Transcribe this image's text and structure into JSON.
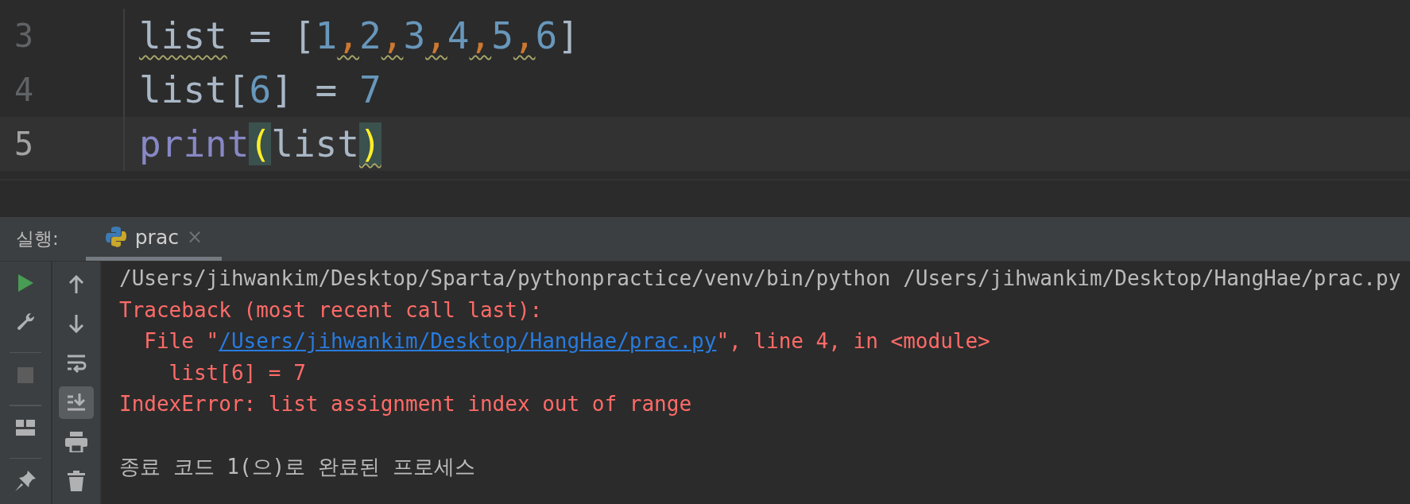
{
  "editor": {
    "lines": [
      {
        "number": "3",
        "current": false,
        "tokens": [
          {
            "text": "list",
            "kind": "identifier",
            "warning": true
          },
          {
            "text": " = [",
            "kind": "operator",
            "warning": false
          },
          {
            "text": "1",
            "kind": "number",
            "warning": false
          },
          {
            "text": ",",
            "kind": "comma",
            "warning": true
          },
          {
            "text": "2",
            "kind": "number",
            "warning": false
          },
          {
            "text": ",",
            "kind": "comma",
            "warning": true
          },
          {
            "text": "3",
            "kind": "number",
            "warning": false
          },
          {
            "text": ",",
            "kind": "comma",
            "warning": true
          },
          {
            "text": "4",
            "kind": "number",
            "warning": false
          },
          {
            "text": ",",
            "kind": "comma",
            "warning": true
          },
          {
            "text": "5",
            "kind": "number",
            "warning": false
          },
          {
            "text": ",",
            "kind": "comma",
            "warning": true
          },
          {
            "text": "6",
            "kind": "number",
            "warning": false
          },
          {
            "text": "]",
            "kind": "operator",
            "warning": false
          }
        ]
      },
      {
        "number": "4",
        "current": false,
        "tokens": [
          {
            "text": "list[",
            "kind": "identifier",
            "warning": false
          },
          {
            "text": "6",
            "kind": "number",
            "warning": false
          },
          {
            "text": "] = ",
            "kind": "operator",
            "warning": false
          },
          {
            "text": "7",
            "kind": "number",
            "warning": false
          }
        ]
      },
      {
        "number": "5",
        "current": true,
        "tokens": [
          {
            "text": "print",
            "kind": "builtin",
            "warning": false
          },
          {
            "text": "(",
            "kind": "paren-match",
            "warning": false
          },
          {
            "text": "list",
            "kind": "identifier",
            "warning": false
          },
          {
            "text": ")",
            "kind": "paren-match",
            "warning": true
          }
        ]
      }
    ]
  },
  "run_panel": {
    "label": "실행:",
    "tabs": [
      {
        "label": "prac",
        "close": "×",
        "selected": true
      }
    ],
    "left_toolbar": [
      {
        "kind": "run",
        "disabled": false
      },
      {
        "kind": "wrench",
        "disabled": false
      },
      {
        "kind": "stop",
        "disabled": true
      },
      {
        "kind": "layout",
        "disabled": false
      },
      {
        "kind": "pin",
        "disabled": false
      }
    ],
    "right_toolbar": [
      {
        "kind": "up",
        "on": false
      },
      {
        "kind": "down",
        "on": false
      },
      {
        "kind": "wrap",
        "on": false
      },
      {
        "kind": "scroll-end",
        "on": true
      },
      {
        "kind": "print",
        "on": false
      },
      {
        "kind": "trash",
        "on": false
      }
    ],
    "console": [
      {
        "segments": [
          {
            "text": "/Users/jihwankim/Desktop/Sparta/pythonpractice/venv/bin/python /Users/jihwankim/Desktop/HangHae/prac.py",
            "kind": "plain"
          }
        ]
      },
      {
        "segments": [
          {
            "text": "Traceback (most recent call last):",
            "kind": "error"
          }
        ]
      },
      {
        "segments": [
          {
            "text": "  File \"",
            "kind": "error"
          },
          {
            "text": "/Users/jihwankim/Desktop/HangHae/prac.py",
            "kind": "link"
          },
          {
            "text": "\", line 4, in <module>",
            "kind": "error"
          }
        ]
      },
      {
        "segments": [
          {
            "text": "    list[6] = 7",
            "kind": "error"
          }
        ]
      },
      {
        "segments": [
          {
            "text": "IndexError: list assignment index out of range",
            "kind": "error"
          }
        ]
      }
    ],
    "exit_message": "종료 코드 1(으)로 완료된 프로세스"
  }
}
